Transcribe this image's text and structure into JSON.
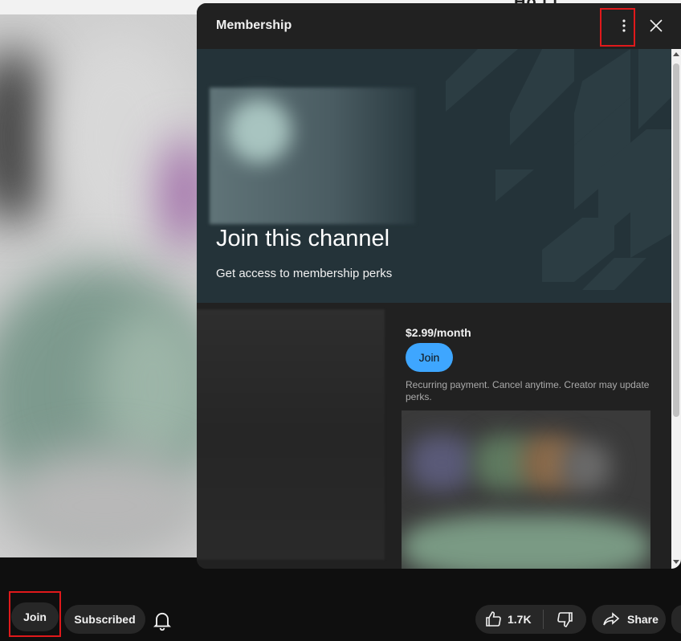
{
  "page": {
    "top_right_partial_text": "Ho  i    i"
  },
  "panel": {
    "title": "Membership",
    "more_icon": "more-vert-icon",
    "close_icon": "close-icon",
    "banner": {
      "title": "Join this channel",
      "subtitle": "Get access to membership perks"
    },
    "tier": {
      "price": "$2.99/month",
      "join_label": "Join",
      "recurring_note": "Recurring payment. Cancel anytime. Creator may update perks."
    }
  },
  "actions": {
    "join_label": "Join",
    "subscribed_label": "Subscribed",
    "bell_icon": "bell-icon",
    "like_icon": "thumbs-up-icon",
    "like_count": "1.7K",
    "dislike_icon": "thumbs-down-icon",
    "share_icon": "share-icon",
    "share_label": "Share"
  },
  "colors": {
    "accent_blue": "#3ea6ff",
    "highlight_red": "#e0191b",
    "banner_bg": "#243339",
    "panel_bg": "#212121",
    "pill_bg": "#272727"
  }
}
